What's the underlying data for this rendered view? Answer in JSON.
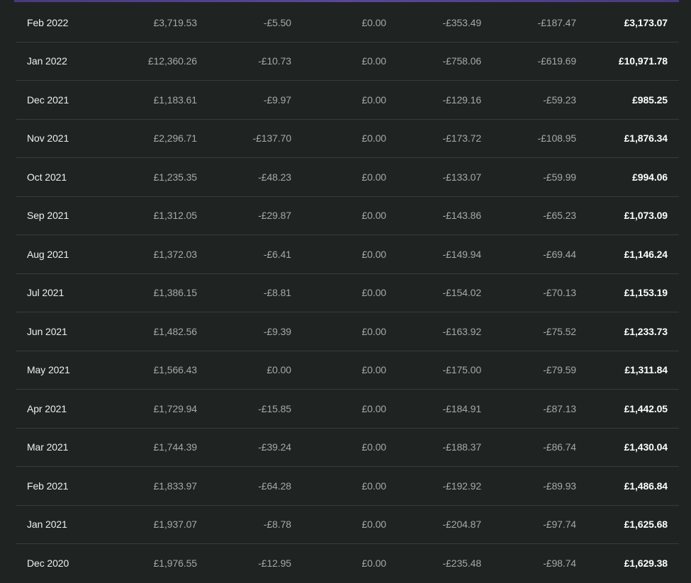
{
  "rows": [
    {
      "month": "Feb 2022",
      "c1": "£3,719.53",
      "c2": "-£5.50",
      "c3": "£0.00",
      "c4": "-£353.49",
      "c5": "-£187.47",
      "net": "£3,173.07"
    },
    {
      "month": "Jan 2022",
      "c1": "£12,360.26",
      "c2": "-£10.73",
      "c3": "£0.00",
      "c4": "-£758.06",
      "c5": "-£619.69",
      "net": "£10,971.78"
    },
    {
      "month": "Dec 2021",
      "c1": "£1,183.61",
      "c2": "-£9.97",
      "c3": "£0.00",
      "c4": "-£129.16",
      "c5": "-£59.23",
      "net": "£985.25"
    },
    {
      "month": "Nov 2021",
      "c1": "£2,296.71",
      "c2": "-£137.70",
      "c3": "£0.00",
      "c4": "-£173.72",
      "c5": "-£108.95",
      "net": "£1,876.34"
    },
    {
      "month": "Oct 2021",
      "c1": "£1,235.35",
      "c2": "-£48.23",
      "c3": "£0.00",
      "c4": "-£133.07",
      "c5": "-£59.99",
      "net": "£994.06"
    },
    {
      "month": "Sep 2021",
      "c1": "£1,312.05",
      "c2": "-£29.87",
      "c3": "£0.00",
      "c4": "-£143.86",
      "c5": "-£65.23",
      "net": "£1,073.09"
    },
    {
      "month": "Aug 2021",
      "c1": "£1,372.03",
      "c2": "-£6.41",
      "c3": "£0.00",
      "c4": "-£149.94",
      "c5": "-£69.44",
      "net": "£1,146.24"
    },
    {
      "month": "Jul 2021",
      "c1": "£1,386.15",
      "c2": "-£8.81",
      "c3": "£0.00",
      "c4": "-£154.02",
      "c5": "-£70.13",
      "net": "£1,153.19"
    },
    {
      "month": "Jun 2021",
      "c1": "£1,482.56",
      "c2": "-£9.39",
      "c3": "£0.00",
      "c4": "-£163.92",
      "c5": "-£75.52",
      "net": "£1,233.73"
    },
    {
      "month": "May 2021",
      "c1": "£1,566.43",
      "c2": "£0.00",
      "c3": "£0.00",
      "c4": "-£175.00",
      "c5": "-£79.59",
      "net": "£1,311.84"
    },
    {
      "month": "Apr 2021",
      "c1": "£1,729.94",
      "c2": "-£15.85",
      "c3": "£0.00",
      "c4": "-£184.91",
      "c5": "-£87.13",
      "net": "£1,442.05"
    },
    {
      "month": "Mar 2021",
      "c1": "£1,744.39",
      "c2": "-£39.24",
      "c3": "£0.00",
      "c4": "-£188.37",
      "c5": "-£86.74",
      "net": "£1,430.04"
    },
    {
      "month": "Feb 2021",
      "c1": "£1,833.97",
      "c2": "-£64.28",
      "c3": "£0.00",
      "c4": "-£192.92",
      "c5": "-£89.93",
      "net": "£1,486.84"
    },
    {
      "month": "Jan 2021",
      "c1": "£1,937.07",
      "c2": "-£8.78",
      "c3": "£0.00",
      "c4": "-£204.87",
      "c5": "-£97.74",
      "net": "£1,625.68"
    },
    {
      "month": "Dec 2020",
      "c1": "£1,976.55",
      "c2": "-£12.95",
      "c3": "£0.00",
      "c4": "-£235.48",
      "c5": "-£98.74",
      "net": "£1,629.38"
    }
  ],
  "colors": {
    "background": "#1f2423",
    "row_divider": "#363d3b",
    "muted_text": "#a4aaa8",
    "primary_text": "#ffffff",
    "accent_bar": "#5b4698"
  }
}
